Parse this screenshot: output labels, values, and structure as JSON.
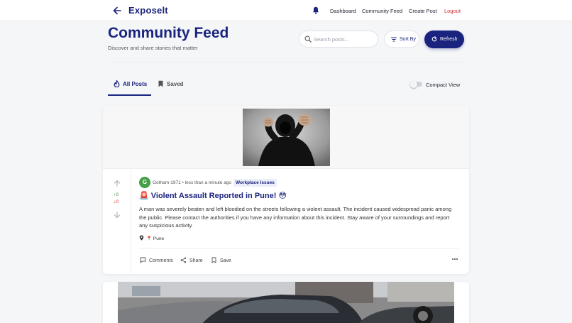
{
  "nav": {
    "brand": "Exposelt",
    "links": [
      "Dashboard",
      "Community Feed",
      "Create Post",
      "Logout"
    ]
  },
  "header": {
    "title": "Community Feed",
    "subtitle": "Discover and share stories that matter",
    "search_placeholder": "Search posts...",
    "sort_label": "Sort By",
    "refresh_label": "Refresh"
  },
  "tabs": [
    {
      "label": "All Posts",
      "active": true
    },
    {
      "label": "Saved",
      "active": false
    }
  ],
  "compact_view": {
    "label": "Compact View",
    "enabled": false
  },
  "post": {
    "upvotes": "0",
    "downvotes": "0",
    "avatar_letter": "G",
    "author": "Gotham-1971",
    "time": "less than a minute ago",
    "meta_line": "Gotham-1971 • less than a minute ago",
    "category": "Workplace Issues",
    "title": "🚨 Violent Assault Reported in Pune! 😳",
    "body": "A man was severely beaten and left bloodied on the streets following a violent assault. The incident caused widespread panic among the public. Please contact the authorities if you have any information about this incident. Stay aware of your surroundings and report any suspicious activity.",
    "location": "📍 Pune",
    "actions": {
      "comments": "Comments",
      "share": "Share",
      "save": "Save"
    }
  },
  "colors": {
    "primary": "#1a237e",
    "logout": "#d32f2f",
    "avatar": "#43a047",
    "upvote": "#2e7d32",
    "downvote": "#c62828"
  }
}
